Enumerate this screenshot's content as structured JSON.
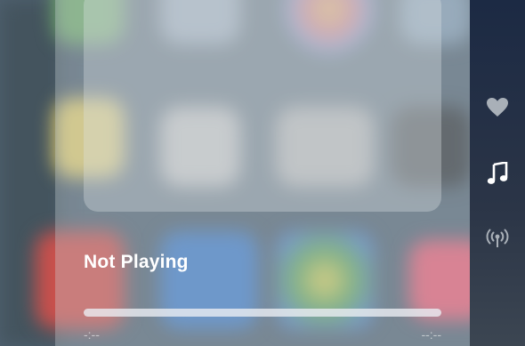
{
  "now_playing": {
    "title": "Not Playing",
    "elapsed": "-:--",
    "remaining": "--:--",
    "progress": 0
  },
  "rail": {
    "items": [
      {
        "icon": "heart-icon",
        "active": false
      },
      {
        "icon": "music-note-icon",
        "active": true
      },
      {
        "icon": "broadcast-icon",
        "active": false
      }
    ]
  },
  "colors": {
    "rail_active": "#ffffff",
    "rail_inactive": "#a9b0b8",
    "text": "#ffffff"
  }
}
